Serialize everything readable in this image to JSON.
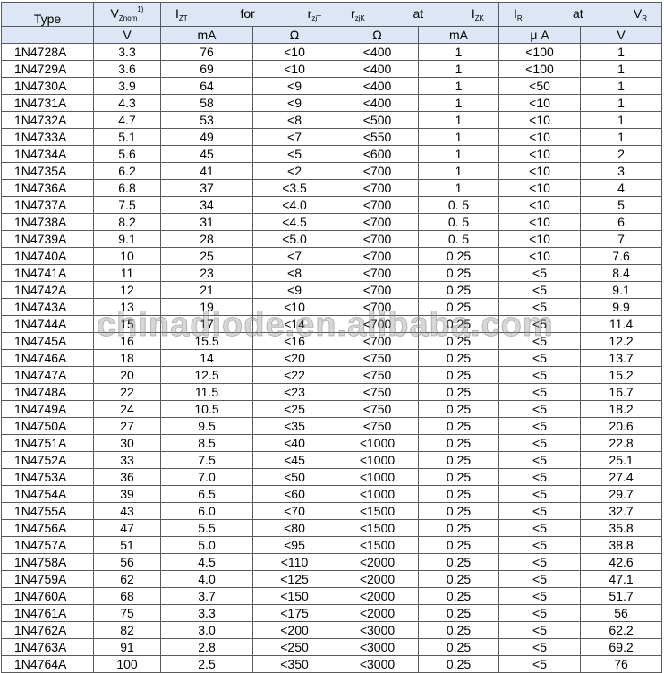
{
  "header": {
    "type": "Type",
    "vz": {
      "main": "V",
      "sub": "Znom",
      "sup": "1)"
    },
    "izt": {
      "main": "I",
      "sub": "ZT"
    },
    "for": "for",
    "rzit": {
      "main": "r",
      "sub": "zjT"
    },
    "rzik": {
      "main": "r",
      "sub": "zjK"
    },
    "at1": "at",
    "izk": {
      "main": "I",
      "sub": "ZK"
    },
    "ir": {
      "main": "I",
      "sub": "R"
    },
    "at2": "at",
    "vr": {
      "main": "V",
      "sub": "R"
    }
  },
  "units": [
    "",
    "V",
    "mA",
    "Ω",
    "Ω",
    "mA",
    "μ A",
    "V"
  ],
  "rows": [
    [
      "1N4728A",
      "3.3",
      "76",
      "<10",
      "<400",
      "1",
      "<100",
      "1"
    ],
    [
      "1N4729A",
      "3.6",
      "69",
      "<10",
      "<400",
      "1",
      "<100",
      "1"
    ],
    [
      "1N4730A",
      "3.9",
      "64",
      "<9",
      "<400",
      "1",
      "<50",
      "1"
    ],
    [
      "1N4731A",
      "4.3",
      "58",
      "<9",
      "<400",
      "1",
      "<10",
      "1"
    ],
    [
      "1N4732A",
      "4.7",
      "53",
      "<8",
      "<500",
      "1",
      "<10",
      "1"
    ],
    [
      "1N4733A",
      "5.1",
      "49",
      "<7",
      "<550",
      "1",
      "<10",
      "1"
    ],
    [
      "1N4734A",
      "5.6",
      "45",
      "<5",
      "<600",
      "1",
      "<10",
      "2"
    ],
    [
      "1N4735A",
      "6.2",
      "41",
      "<2",
      "<700",
      "1",
      "<10",
      "3"
    ],
    [
      "1N4736A",
      "6.8",
      "37",
      "<3.5",
      "<700",
      "1",
      "<10",
      "4"
    ],
    [
      "1N4737A",
      "7.5",
      "34",
      "<4.0",
      "<700",
      "0. 5",
      "<10",
      "5"
    ],
    [
      "1N4738A",
      "8.2",
      "31",
      "<4.5",
      "<700",
      "0. 5",
      "<10",
      "6"
    ],
    [
      "1N4739A",
      "9.1",
      "28",
      "<5.0",
      "<700",
      "0. 5",
      "<10",
      "7"
    ],
    [
      "1N4740A",
      "10",
      "25",
      "<7",
      "<700",
      "0.25",
      "<10",
      "7.6"
    ],
    [
      "1N4741A",
      "11",
      "23",
      "<8",
      "<700",
      "0.25",
      "<5",
      "8.4"
    ],
    [
      "1N4742A",
      "12",
      "21",
      "<9",
      "<700",
      "0.25",
      "<5",
      "9.1"
    ],
    [
      "1N4743A",
      "13",
      "19",
      "<10",
      "<700",
      "0.25",
      "<5",
      "9.9"
    ],
    [
      "1N4744A",
      "15",
      "17",
      "<14",
      "<700",
      "0.25",
      "<5",
      "11.4"
    ],
    [
      "1N4745A",
      "16",
      "15.5",
      "<16",
      "<700",
      "0.25",
      "<5",
      "12.2"
    ],
    [
      "1N4746A",
      "18",
      "14",
      "<20",
      "<750",
      "0.25",
      "<5",
      "13.7"
    ],
    [
      "1N4747A",
      "20",
      "12.5",
      "<22",
      "<750",
      "0.25",
      "<5",
      "15.2"
    ],
    [
      "1N4748A",
      "22",
      "11.5",
      "<23",
      "<750",
      "0.25",
      "<5",
      "16.7"
    ],
    [
      "1N4749A",
      "24",
      "10.5",
      "<25",
      "<750",
      "0.25",
      "<5",
      "18.2"
    ],
    [
      "1N4750A",
      "27",
      "9.5",
      "<35",
      "<750",
      "0.25",
      "<5",
      "20.6"
    ],
    [
      "1N4751A",
      "30",
      "8.5",
      "<40",
      "<1000",
      "0.25",
      "<5",
      "22.8"
    ],
    [
      "1N4752A",
      "33",
      "7.5",
      "<45",
      "<1000",
      "0.25",
      "<5",
      "25.1"
    ],
    [
      "1N4753A",
      "36",
      "7.0",
      "<50",
      "<1000",
      "0.25",
      "<5",
      "27.4"
    ],
    [
      "1N4754A",
      "39",
      "6.5",
      "<60",
      "<1000",
      "0.25",
      "<5",
      "29.7"
    ],
    [
      "1N4755A",
      "43",
      "6.0",
      "<70",
      "<1500",
      "0.25",
      "<5",
      "32.7"
    ],
    [
      "1N4756A",
      "47",
      "5.5",
      "<80",
      "<1500",
      "0.25",
      "<5",
      "35.8"
    ],
    [
      "1N4757A",
      "51",
      "5.0",
      "<95",
      "<1500",
      "0.25",
      "<5",
      "38.8"
    ],
    [
      "1N4758A",
      "56",
      "4.5",
      "<110",
      "<2000",
      "0.25",
      "<5",
      "42.6"
    ],
    [
      "1N4759A",
      "62",
      "4.0",
      "<125",
      "<2000",
      "0.25",
      "<5",
      "47.1"
    ],
    [
      "1N4760A",
      "68",
      "3.7",
      "<150",
      "<2000",
      "0.25",
      "<5",
      "51.7"
    ],
    [
      "1N4761A",
      "75",
      "3.3",
      "<175",
      "<2000",
      "0.25",
      "<5",
      "56"
    ],
    [
      "1N4762A",
      "82",
      "3.0",
      "<200",
      "<3000",
      "0.25",
      "<5",
      "62.2"
    ],
    [
      "1N4763A",
      "91",
      "2.8",
      "<250",
      "<3000",
      "0.25",
      "<5",
      "69.2"
    ],
    [
      "1N4764A",
      "100",
      "2.5",
      "<350",
      "<3000",
      "0.25",
      "<5",
      "76"
    ]
  ],
  "watermark": "chinadiode.en.alibaba.com",
  "colors": {
    "header_bg": "#dde6f4",
    "border": "#5a5a5a"
  }
}
